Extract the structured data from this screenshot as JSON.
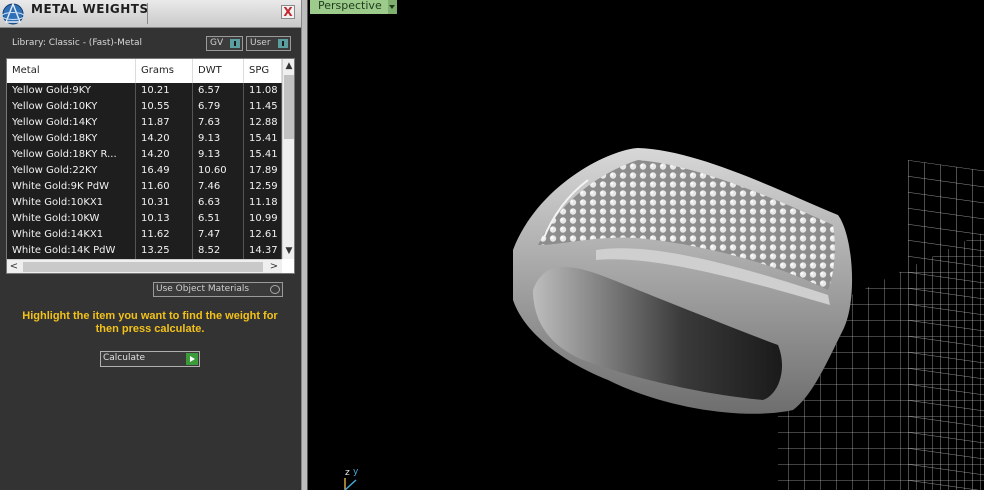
{
  "panel": {
    "title": "METAL WEIGHTS",
    "close_label": "X",
    "library_label": "Library: Classic - (Fast)-Metal",
    "toggles": [
      {
        "label": "GV"
      },
      {
        "label": "User"
      }
    ],
    "table": {
      "columns": [
        "Metal",
        "Grams",
        "DWT",
        "SPG"
      ],
      "rows": [
        [
          "Yellow Gold:9KY",
          "10.21",
          "6.57",
          "11.08"
        ],
        [
          "Yellow Gold:10KY",
          "10.55",
          "6.79",
          "11.45"
        ],
        [
          "Yellow Gold:14KY",
          "11.87",
          "7.63",
          "12.88"
        ],
        [
          "Yellow Gold:18KY",
          "14.20",
          "9.13",
          "15.41"
        ],
        [
          "Yellow Gold:18KY R...",
          "14.20",
          "9.13",
          "15.41"
        ],
        [
          "Yellow Gold:22KY",
          "16.49",
          "10.60",
          "17.89"
        ],
        [
          "White Gold:9K PdW",
          "11.60",
          "7.46",
          "12.59"
        ],
        [
          "White Gold:10KX1",
          "10.31",
          "6.63",
          "11.18"
        ],
        [
          "White Gold:10KW",
          "10.13",
          "6.51",
          "10.99"
        ],
        [
          "White Gold:14KX1",
          "11.62",
          "7.47",
          "12.61"
        ],
        [
          "White Gold:14K PdW",
          "13.25",
          "8.52",
          "14.37"
        ]
      ]
    },
    "use_object_materials_label": "Use Object Materials",
    "hint": "Highlight the item you want to find the weight for then press calculate.",
    "calculate_label": "Calculate"
  },
  "viewport": {
    "label": "Perspective",
    "axis_labels": {
      "z": "z",
      "y": "y"
    }
  },
  "colors": {
    "panel_bg": "#333333",
    "hint_text": "#f2c21a",
    "view_label_bg": "#9ccb8c",
    "calc_play": "#3b9b3b"
  }
}
